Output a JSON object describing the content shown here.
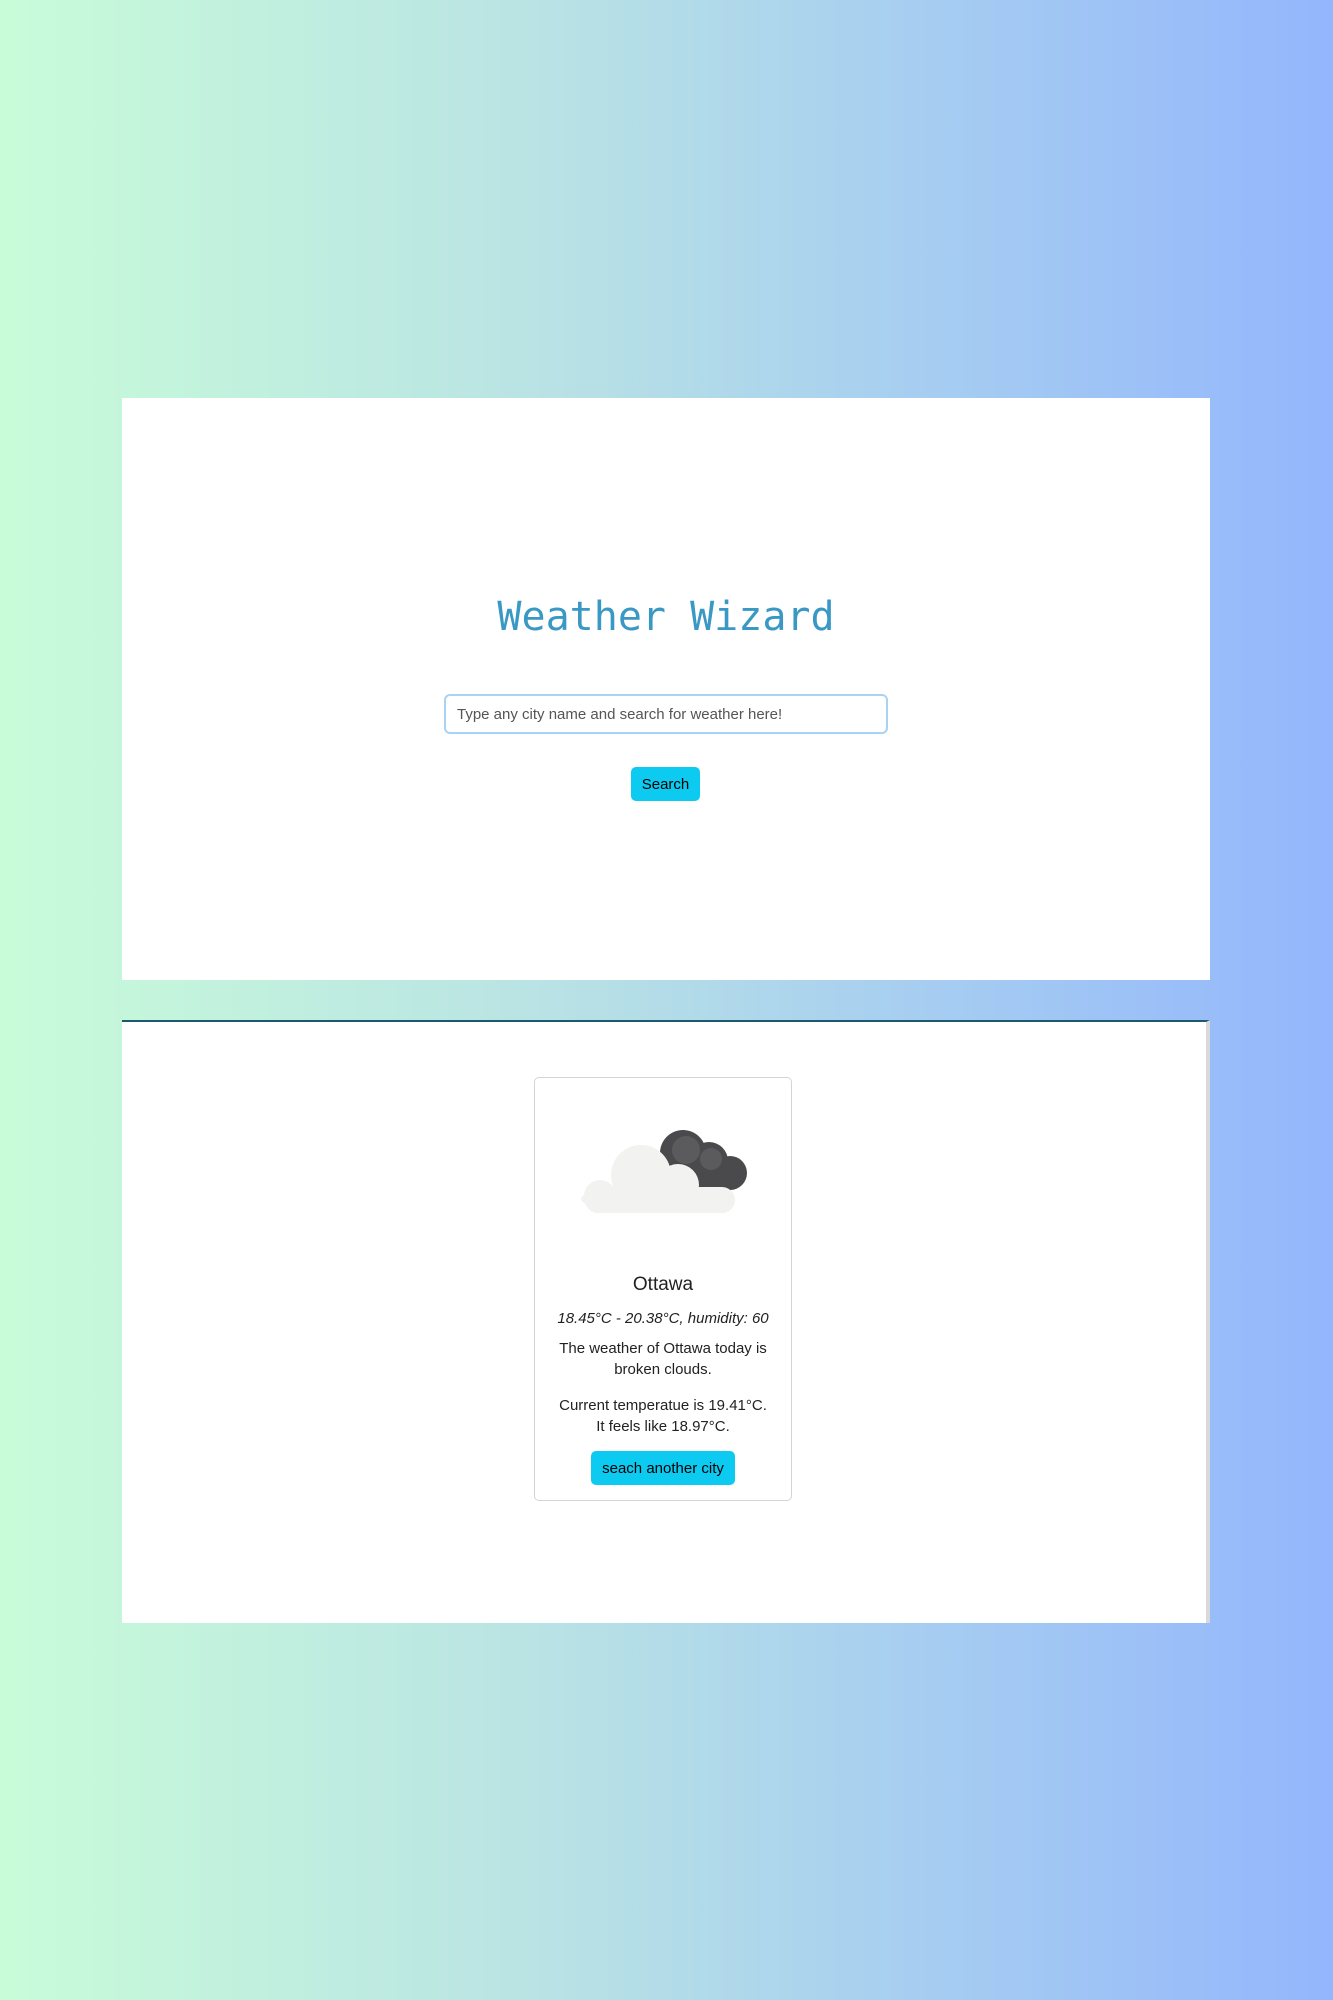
{
  "app": {
    "title": "Weather Wizard"
  },
  "search": {
    "placeholder": "Type any city name and search for weather here!",
    "value": "",
    "button_label": "Search"
  },
  "result": {
    "icon": "broken-clouds-icon",
    "city": "Ottawa",
    "temp_range": "18.45°C - 20.38°C, humidity: 60",
    "description": "The weather of Ottawa today is broken clouds.",
    "current": "Current temperatue is 19.41°C. It feels like 18.97°C.",
    "again_button_label": "seach another city"
  },
  "colors": {
    "title": "#3a98c4",
    "button": "#0dcaf0",
    "gradient_left": "#c8fcd9",
    "gradient_right": "#93b6fc"
  }
}
